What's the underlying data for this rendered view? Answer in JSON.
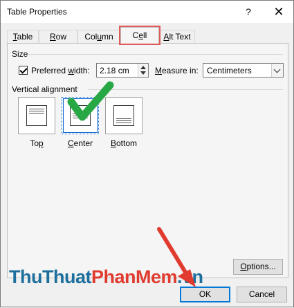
{
  "window": {
    "title": "Table Properties",
    "help_glyph": "?",
    "close_glyph": "✕"
  },
  "tabs": [
    {
      "label_u": "T",
      "label_rest": "able",
      "active": false
    },
    {
      "label_u": "R",
      "label_rest": "ow",
      "active": false
    },
    {
      "label_pre": "Col",
      "label_u": "u",
      "label_rest": "mn",
      "active": false
    },
    {
      "label_pre": "C",
      "label_u": "e",
      "label_rest": "ll",
      "active": true
    },
    {
      "label_u": "A",
      "label_rest": "lt Text",
      "active": false
    }
  ],
  "size": {
    "group_label": "Size",
    "preferred_width_checked": true,
    "preferred_width_label_pre": "Preferred ",
    "preferred_width_label_u": "w",
    "preferred_width_label_rest": "idth:",
    "width_value": "2.18 cm",
    "measure_label_pre": "",
    "measure_label_u": "M",
    "measure_label_rest": "easure in:",
    "measure_value": "Centimeters"
  },
  "vertical_alignment": {
    "group_label": "Vertical alignment",
    "options": [
      {
        "label_pre": "To",
        "label_u": "p",
        "label_rest": "",
        "selected": false
      },
      {
        "label_pre": "",
        "label_u": "C",
        "label_rest": "enter",
        "selected": true
      },
      {
        "label_pre": "",
        "label_u": "B",
        "label_rest": "ottom",
        "selected": false
      }
    ]
  },
  "buttons": {
    "options_pre": "",
    "options_u": "O",
    "options_rest": "ptions...",
    "ok": "OK",
    "cancel": "Cancel"
  },
  "watermark": {
    "part1": "Thu",
    "part2": "Thuat",
    "part3": "PhanMem",
    "part4": ".vn"
  },
  "colors": {
    "watermark_dark": "#1d6f9d",
    "watermark_red": "#e03b2e",
    "check_green": "#28a745",
    "arrow_red": "#e03b2e",
    "tab_highlight": "#e05a5a",
    "default_button": "#0078d7"
  },
  "annotations": {
    "check_icon": "green-check-icon",
    "arrow_icon": "red-arrow-icon"
  }
}
